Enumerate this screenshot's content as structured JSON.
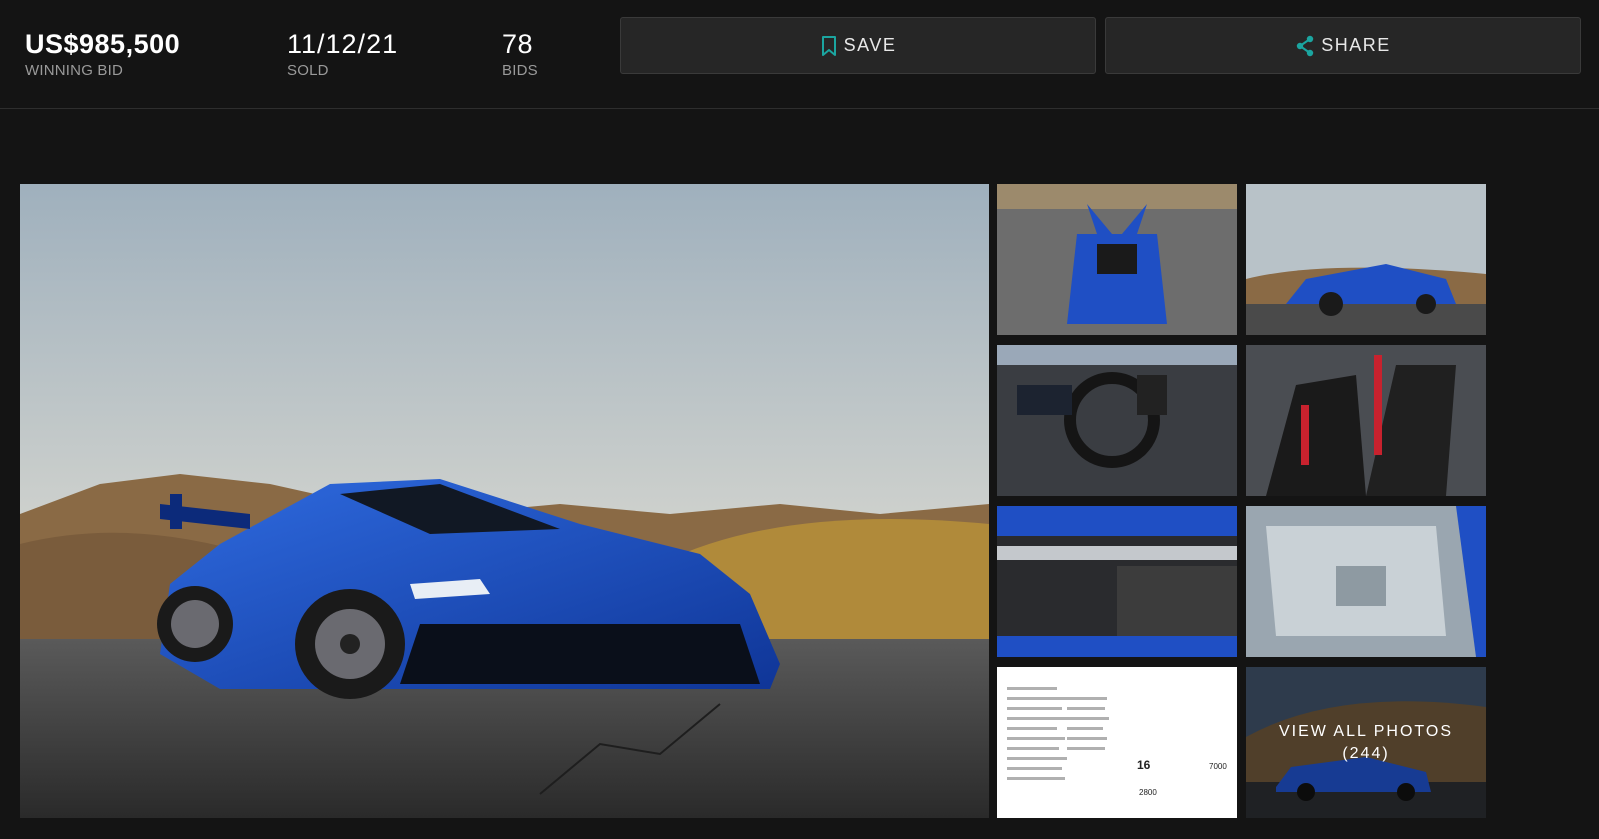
{
  "stats": {
    "winning_bid": {
      "value": "US$985,500",
      "label": "WINNING BID"
    },
    "sold": {
      "value": "11/12/21",
      "label": "SOLD"
    },
    "bids": {
      "value": "78",
      "label": "BIDS"
    }
  },
  "actions": {
    "save_label": "SAVE",
    "share_label": "SHARE"
  },
  "gallery": {
    "view_all_label": "VIEW ALL PHOTOS",
    "view_all_count": "(244)",
    "document_text": {
      "number": "16",
      "value_a": "7000",
      "value_b": "2800"
    }
  },
  "colors": {
    "background": "#141414",
    "accent": "#1ba5a0",
    "car_blue": "#1f4fc4"
  },
  "icons": {
    "save": "bookmark-icon",
    "share": "share-icon"
  }
}
